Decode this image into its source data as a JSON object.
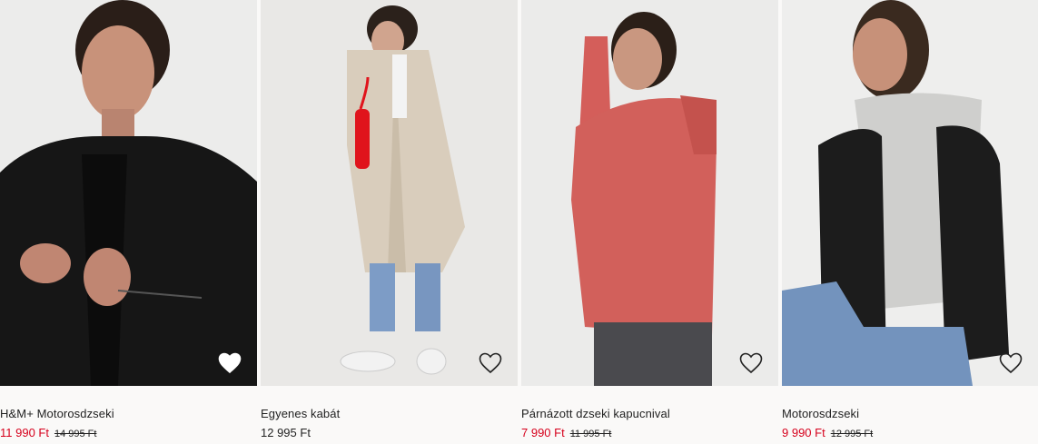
{
  "products": [
    {
      "name": "H&M+ Motorosdzseki",
      "price": "11 990 Ft",
      "old_price": "14 995 Ft",
      "on_sale": true,
      "favorite_icon": "heart-outline-icon"
    },
    {
      "name": "Egyenes kabát",
      "price": "12 995 Ft",
      "old_price": "",
      "on_sale": false,
      "favorite_icon": "heart-outline-icon"
    },
    {
      "name": "Párnázott dzseki kapucnival",
      "price": "7 990 Ft",
      "old_price": "11 995 Ft",
      "on_sale": true,
      "favorite_icon": "heart-outline-icon"
    },
    {
      "name": "Motorosdzseki",
      "price": "9 990 Ft",
      "old_price": "12 995 Ft",
      "on_sale": true,
      "favorite_icon": "heart-outline-icon"
    }
  ],
  "colors": {
    "sale_price": "#d6001c",
    "text": "#222222",
    "background": "#faf9f8"
  }
}
